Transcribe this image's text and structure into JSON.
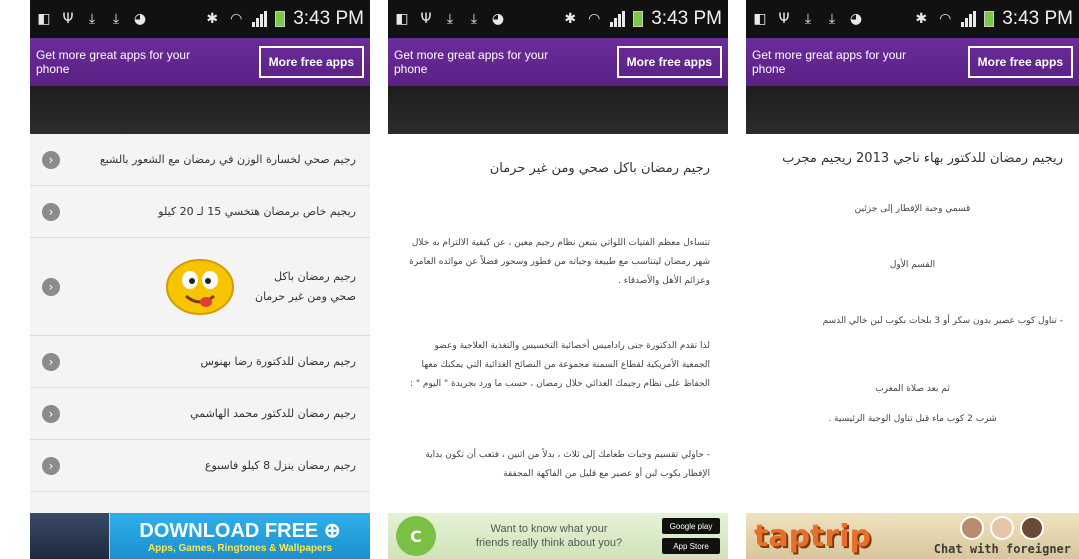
{
  "status_bar": {
    "time": "3:43 PM"
  },
  "ad_bar": {
    "text": "Get more great apps for your phone",
    "button_label": "More free apps"
  },
  "screen1": {
    "items": [
      {
        "label": "رجيم صحي لخسارة الوزن في رمضان مع الشعور بالشبع"
      },
      {
        "label": "ريجيم خاص برمضان هتخسي 15 لـ 20 كيلو"
      },
      {
        "label": "رجيم رمضان باكل صحي ومن غير حرمان"
      },
      {
        "label": "رجيم رمضان للدكتورة رضا بهنوس"
      },
      {
        "label": "رجيم رمضان للدكتور محمد الهاشمي"
      },
      {
        "label": "رجيم رمضان ينزل 8 كيلو فاسبوع"
      }
    ],
    "banner": {
      "headline": "DOWNLOAD FREE ⊕",
      "subline": "Apps, Games, Ringtones & Wallpapers"
    }
  },
  "screen2": {
    "title": "رجيم رمضان باكل صحي ومن غير حرمان",
    "paragraphs": [
      "تتساءل معظم الفتيات اللواتي يتبعن نظام رجيم معين ، عن كيفية الالتزام به خلال شهر رمضان ليتناسب مع طبيعة وجباته من فطور وسحور فضلاً عن موائده العامرة وعزائم الأهل والأصدقاء .",
      "لذا تقدم الدكتورة جنى راداميس أخصائية التخسيس والتغذية العلاجية وعضو الجمعية الأمريكية لقطاع السمنة مجموعة من النصائح الغذائية التي يمكنك معها الحفاظ على نظام رجيمك الغذائي خلال رمضان ، حسب ما ورد بجريدة \" اليوم \" :",
      "- حاولي تقسيم وجبات طعامك إلى ثلاث ، بدلاً من اثنين ، فتعب أن تكون بداية الإفطار بكوب لبن أو عصير مع قليل من الفاكهة المجففة"
    ],
    "banner": {
      "message_1": "Want to know what your",
      "message_2": "friends really think about you?",
      "store_1": "Google play",
      "store_2": "App Store",
      "logo": "C"
    }
  },
  "screen3": {
    "title": "ريجيم رمضان للدكتور بهاء ناجي 2013 ريجيم مجرب",
    "lines": [
      "قسمي وجبة الإفطار إلى جزئين",
      "القسم الأول",
      "- تناول كوب عصير بدون سكر أو 3 بلحات بكوب لبن خالي الدسم",
      "ثم بعد صلاة المغرب",
      "شرب 2 كوب ماء قبل تناول الوجبة الرئيسية ."
    ],
    "banner": {
      "brand": "taptrip",
      "chat": "Chat with foreigner"
    }
  }
}
